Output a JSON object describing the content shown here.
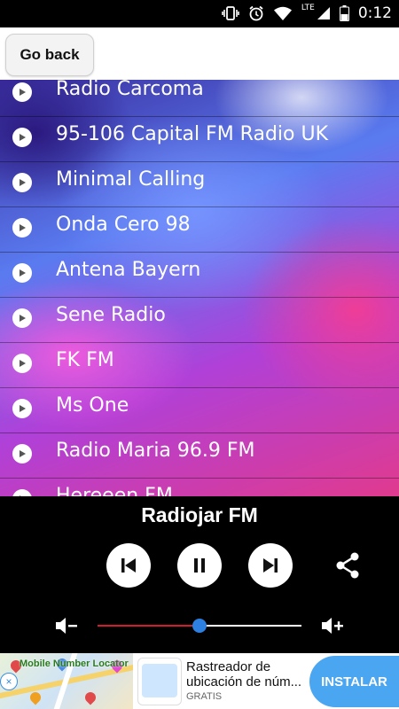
{
  "status_bar": {
    "network": "LTE",
    "time": "0:12",
    "icons": [
      "vibrate-icon",
      "alarm-icon",
      "wifi-icon",
      "signal-icon",
      "battery-icon"
    ]
  },
  "header": {
    "back_label": "Go back"
  },
  "stations": [
    {
      "name": "Radio Carcoma"
    },
    {
      "name": "95-106 Capital FM Radio UK"
    },
    {
      "name": "Minimal Calling"
    },
    {
      "name": "Onda Cero 98"
    },
    {
      "name": "Antena Bayern"
    },
    {
      "name": "Sene Radio"
    },
    {
      "name": "FK FM"
    },
    {
      "name": "Ms One"
    },
    {
      "name": "Radio Maria 96.9 FM"
    },
    {
      "name": "Hereeen FM"
    }
  ],
  "player": {
    "now_playing": "Radiojar FM",
    "volume_level": 0.5,
    "controls": [
      "previous-icon",
      "pause-icon",
      "next-icon",
      "share-icon"
    ]
  },
  "ad": {
    "app_name": "Mobile Number Locator",
    "title": "Rastreador de ubicación de núm...",
    "subtitle": "GRATIS",
    "cta": "INSTALAR"
  }
}
